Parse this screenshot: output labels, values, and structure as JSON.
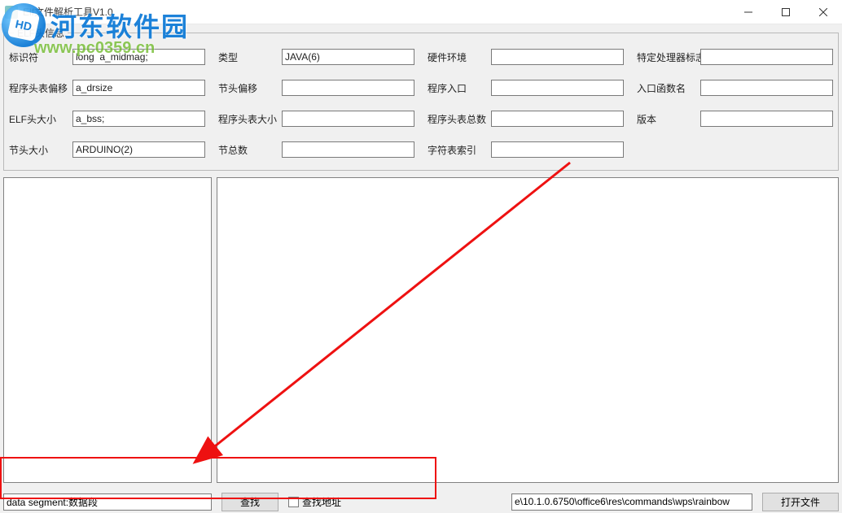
{
  "window": {
    "title": "Elf文件解析工具V1.0"
  },
  "watermark": {
    "brand": "河东软件园",
    "url": "www.pc0359.cn",
    "logo_letters": "HD"
  },
  "headerGroup": {
    "legend": "ELF头信息",
    "fields": {
      "identifier": {
        "label": "标识符",
        "value": "long  a_midmag;"
      },
      "type": {
        "label": "类型",
        "value": "JAVA(6)"
      },
      "hardware": {
        "label": "硬件环境",
        "value": ""
      },
      "cpu_flags": {
        "label": "特定处理器标志",
        "value": ""
      },
      "ph_offset": {
        "label": "程序头表偏移",
        "value": "a_drsize"
      },
      "sh_offset": {
        "label": "节头偏移",
        "value": ""
      },
      "entry": {
        "label": "程序入口",
        "value": ""
      },
      "entry_func": {
        "label": "入口函数名",
        "value": ""
      },
      "ehsize": {
        "label": "ELF头大小",
        "value": "a_bss;"
      },
      "phsize": {
        "label": "程序头表大小",
        "value": ""
      },
      "phnum": {
        "label": "程序头表总数",
        "value": ""
      },
      "version": {
        "label": "版本",
        "value": ""
      },
      "shsize": {
        "label": "节头大小",
        "value": "ARDUINO(2)"
      },
      "shnum": {
        "label": "节总数",
        "value": ""
      },
      "shstrndx": {
        "label": "字符表索引",
        "value": ""
      }
    }
  },
  "bottom": {
    "search_value": "data segment:数据段",
    "search_button": "查找",
    "search_address_checkbox": "查找地址",
    "search_address_checked": false,
    "file_path": "e\\10.1.0.6750\\office6\\res\\commands\\wps\\rainbow",
    "open_file_button": "打开文件"
  }
}
